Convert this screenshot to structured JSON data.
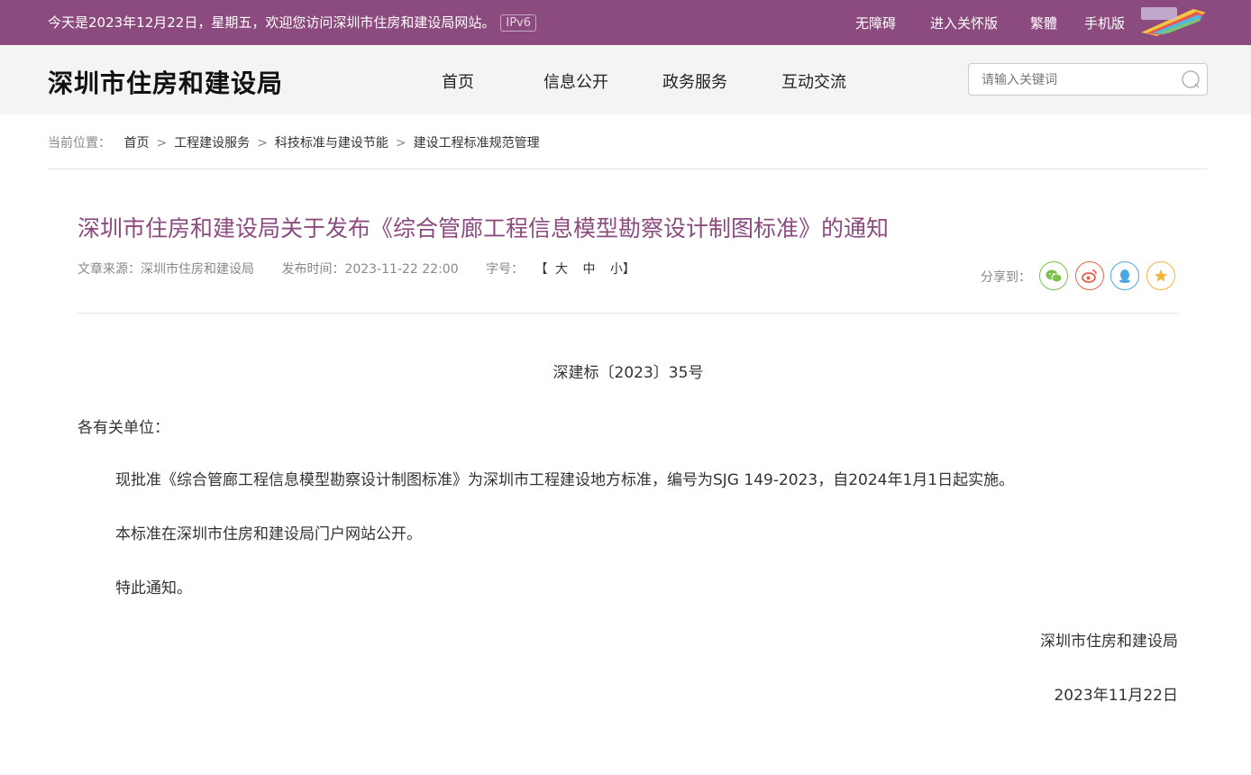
{
  "topbar": {
    "welcome": "今天是2023年12月22日，星期五，欢迎您访问深圳市住房和建设局网站。",
    "ipv6": "IPv6",
    "links": [
      "无障碍",
      "进入关怀版",
      "繁體",
      "手机版"
    ],
    "bg_color": "#8c4b7e"
  },
  "header": {
    "site_title": "深圳市住房和建设局",
    "nav": [
      "首页",
      "信息公开",
      "政务服务",
      "互动交流"
    ],
    "search_placeholder": "请输入关键词"
  },
  "breadcrumb": {
    "label": "当前位置：",
    "items": [
      "首页",
      "工程建设服务",
      "科技标准与建设节能",
      "建设工程标准规范管理"
    ],
    "separator": ">"
  },
  "article": {
    "title": "深圳市住房和建设局关于发布《综合管廊工程信息模型勘察设计制图标准》的通知",
    "source_label": "文章来源：",
    "source": "深圳市住房和建设局",
    "date_label": "发布时间：",
    "date": "2023-11-22 22:00",
    "font_label": "字号：",
    "font_open": "【",
    "font_sizes": [
      "大",
      "中",
      "小"
    ],
    "font_close": "】",
    "share_label": "分享到：",
    "share_icons": [
      "wechat-icon",
      "weibo-icon",
      "qq-icon",
      "qzone-star-icon"
    ],
    "doc_number": "深建标〔2023〕35号",
    "salutation": "各有关单位：",
    "paragraphs": [
      "现批准《综合管廊工程信息模型勘察设计制图标准》为深圳市工程建设地方标准，编号为SJG 149-2023，自2024年1月1日起实施。",
      "本标准在深圳市住房和建设局门户网站公开。",
      "特此通知。"
    ],
    "signature": "深圳市住房和建设局",
    "sign_date": "2023年11月22日"
  }
}
